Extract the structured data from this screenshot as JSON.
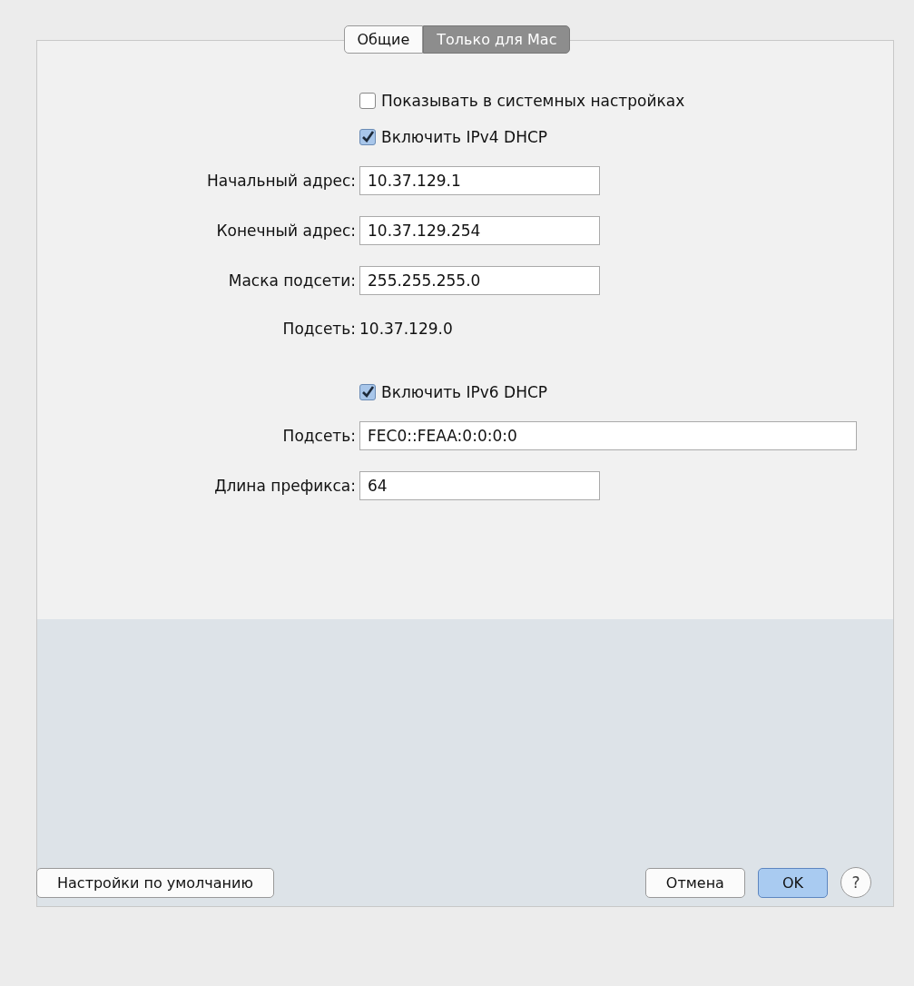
{
  "tabs": [
    {
      "label": "Общие",
      "selected": false
    },
    {
      "label": "Только для Mac",
      "selected": true
    }
  ],
  "rows": [
    {
      "kind": "checkbox",
      "label": "Показывать в системных настройках",
      "checked": false
    },
    {
      "kind": "checkbox",
      "label": "Включить IPv4 DHCP",
      "checked": true
    },
    {
      "kind": "field",
      "label": "Начальный адрес:",
      "value": "10.37.129.1"
    },
    {
      "kind": "field",
      "label": "Конечный адрес:",
      "value": "10.37.129.254"
    },
    {
      "kind": "field",
      "label": "Маска подсети:",
      "value": "255.255.255.0"
    },
    {
      "kind": "text",
      "label": "Подсеть:",
      "value": "10.37.129.0"
    },
    {
      "kind": "checkbox",
      "label": "Включить IPv6 DHCP",
      "checked": true
    },
    {
      "kind": "widefield",
      "label": "Подсеть:",
      "value": "FEC0::FEAA:0:0:0:0"
    },
    {
      "kind": "field",
      "label": "Длина префикса:",
      "value": "64"
    }
  ],
  "buttons": {
    "defaults": "Настройки по умолчанию",
    "cancel": "Отмена",
    "ok": "OK",
    "help": "?"
  }
}
